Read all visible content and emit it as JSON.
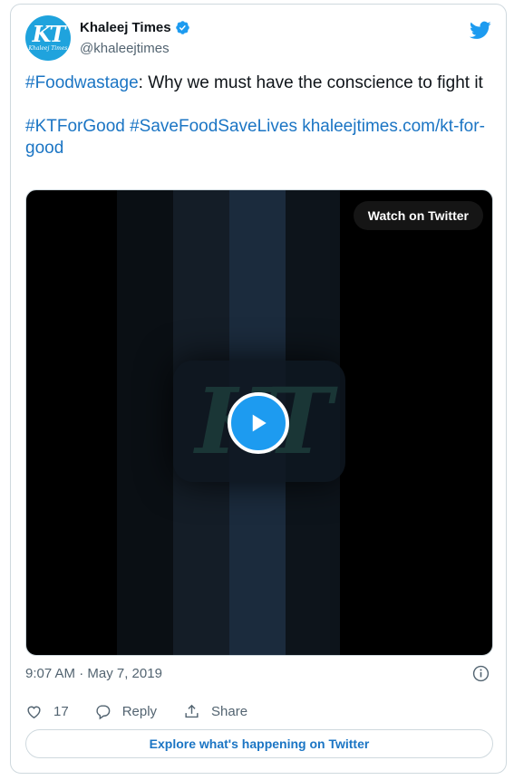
{
  "author": {
    "display_name": "Khaleej Times",
    "handle": "@khaleejtimes",
    "avatar_monogram": "KT",
    "avatar_subtitle": "Khaleej Times",
    "verified": true
  },
  "tweet": {
    "hashtag_1": "#Foodwastage",
    "text_1": ": Why we must have the conscience to fight it",
    "hashtag_2": "#KTForGood",
    "hashtag_3": "#SaveFoodSaveLives",
    "link": "khaleejtimes.com/kt-for-good"
  },
  "media": {
    "watch_label": "Watch on Twitter",
    "logo_monogram": "KT"
  },
  "meta": {
    "timestamp": "9:07 AM · May 7, 2019"
  },
  "actions": {
    "like_count": "17",
    "reply_label": "Reply",
    "share_label": "Share"
  },
  "footer": {
    "explore_label": "Explore what's happening on Twitter"
  },
  "colors": {
    "link": "#1b75c4",
    "brand": "#1d9bf0",
    "muted": "#536471"
  },
  "icons": [
    "verified-badge-icon",
    "twitter-bird-icon",
    "play-icon",
    "info-icon",
    "heart-icon",
    "reply-bubble-icon",
    "share-icon"
  ]
}
